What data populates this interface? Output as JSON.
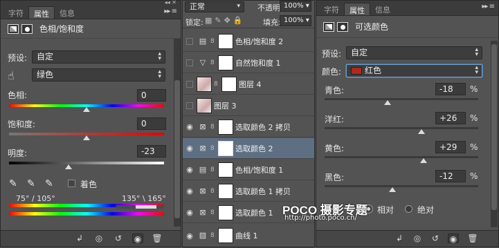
{
  "left": {
    "tabs": [
      "字符",
      "属性",
      "信息"
    ],
    "header": "色相/饱和度",
    "preset_label": "预设:",
    "preset_value": "自定",
    "channel_value": "绿色",
    "hue_label": "色相:",
    "hue_value": "0",
    "sat_label": "饱和度:",
    "sat_value": "0",
    "light_label": "明度:",
    "light_value": "-23",
    "colorize_label": "着色",
    "range_left": "75° / 105°",
    "range_right": "135° \\ 165°"
  },
  "mid": {
    "blend_mode": "正常",
    "opacity_label": "不透明度:",
    "opacity_value": "100%",
    "lock_label": "锁定:",
    "fill_label": "填充:",
    "fill_value": "100%",
    "layers": [
      {
        "name": "色相/饱和度 2",
        "type": "hs",
        "visible": false
      },
      {
        "name": "自然饱和度 1",
        "type": "vib",
        "visible": false
      },
      {
        "name": "图层 4",
        "type": "img",
        "visible": false
      },
      {
        "name": "图层 3",
        "type": "img",
        "visible": false
      },
      {
        "name": "选取颜色 2 拷贝",
        "type": "sel",
        "visible": true
      },
      {
        "name": "选取颜色 2",
        "type": "sel",
        "visible": true,
        "selected": true
      },
      {
        "name": "色相/饱和度 1",
        "type": "hs",
        "visible": true
      },
      {
        "name": "选取颜色 1 拷贝",
        "type": "sel",
        "visible": true
      },
      {
        "name": "选取颜色 1",
        "type": "sel",
        "visible": true
      },
      {
        "name": "曲线 1",
        "type": "curve",
        "visible": true
      }
    ]
  },
  "right": {
    "tabs": [
      "字符",
      "属性",
      "信息"
    ],
    "header": "可选颜色",
    "preset_label": "预设:",
    "preset_value": "自定",
    "color_label": "颜色:",
    "color_value": "红色",
    "color_swatch": "#b8261a",
    "sliders": [
      {
        "label": "青色:",
        "value": "-18",
        "unit": "%",
        "level": 0.41
      },
      {
        "label": "洋红:",
        "value": "+26",
        "unit": "%",
        "level": 0.63
      },
      {
        "label": "黄色:",
        "value": "+29",
        "unit": "%",
        "level": 0.645
      },
      {
        "label": "黑色:",
        "value": "-12",
        "unit": "%",
        "level": 0.44
      }
    ],
    "mode_relative": "相对",
    "mode_absolute": "绝对"
  },
  "watermark": {
    "brand": "POCO 摄影专题",
    "url": "http://photo.poco.cn/"
  }
}
